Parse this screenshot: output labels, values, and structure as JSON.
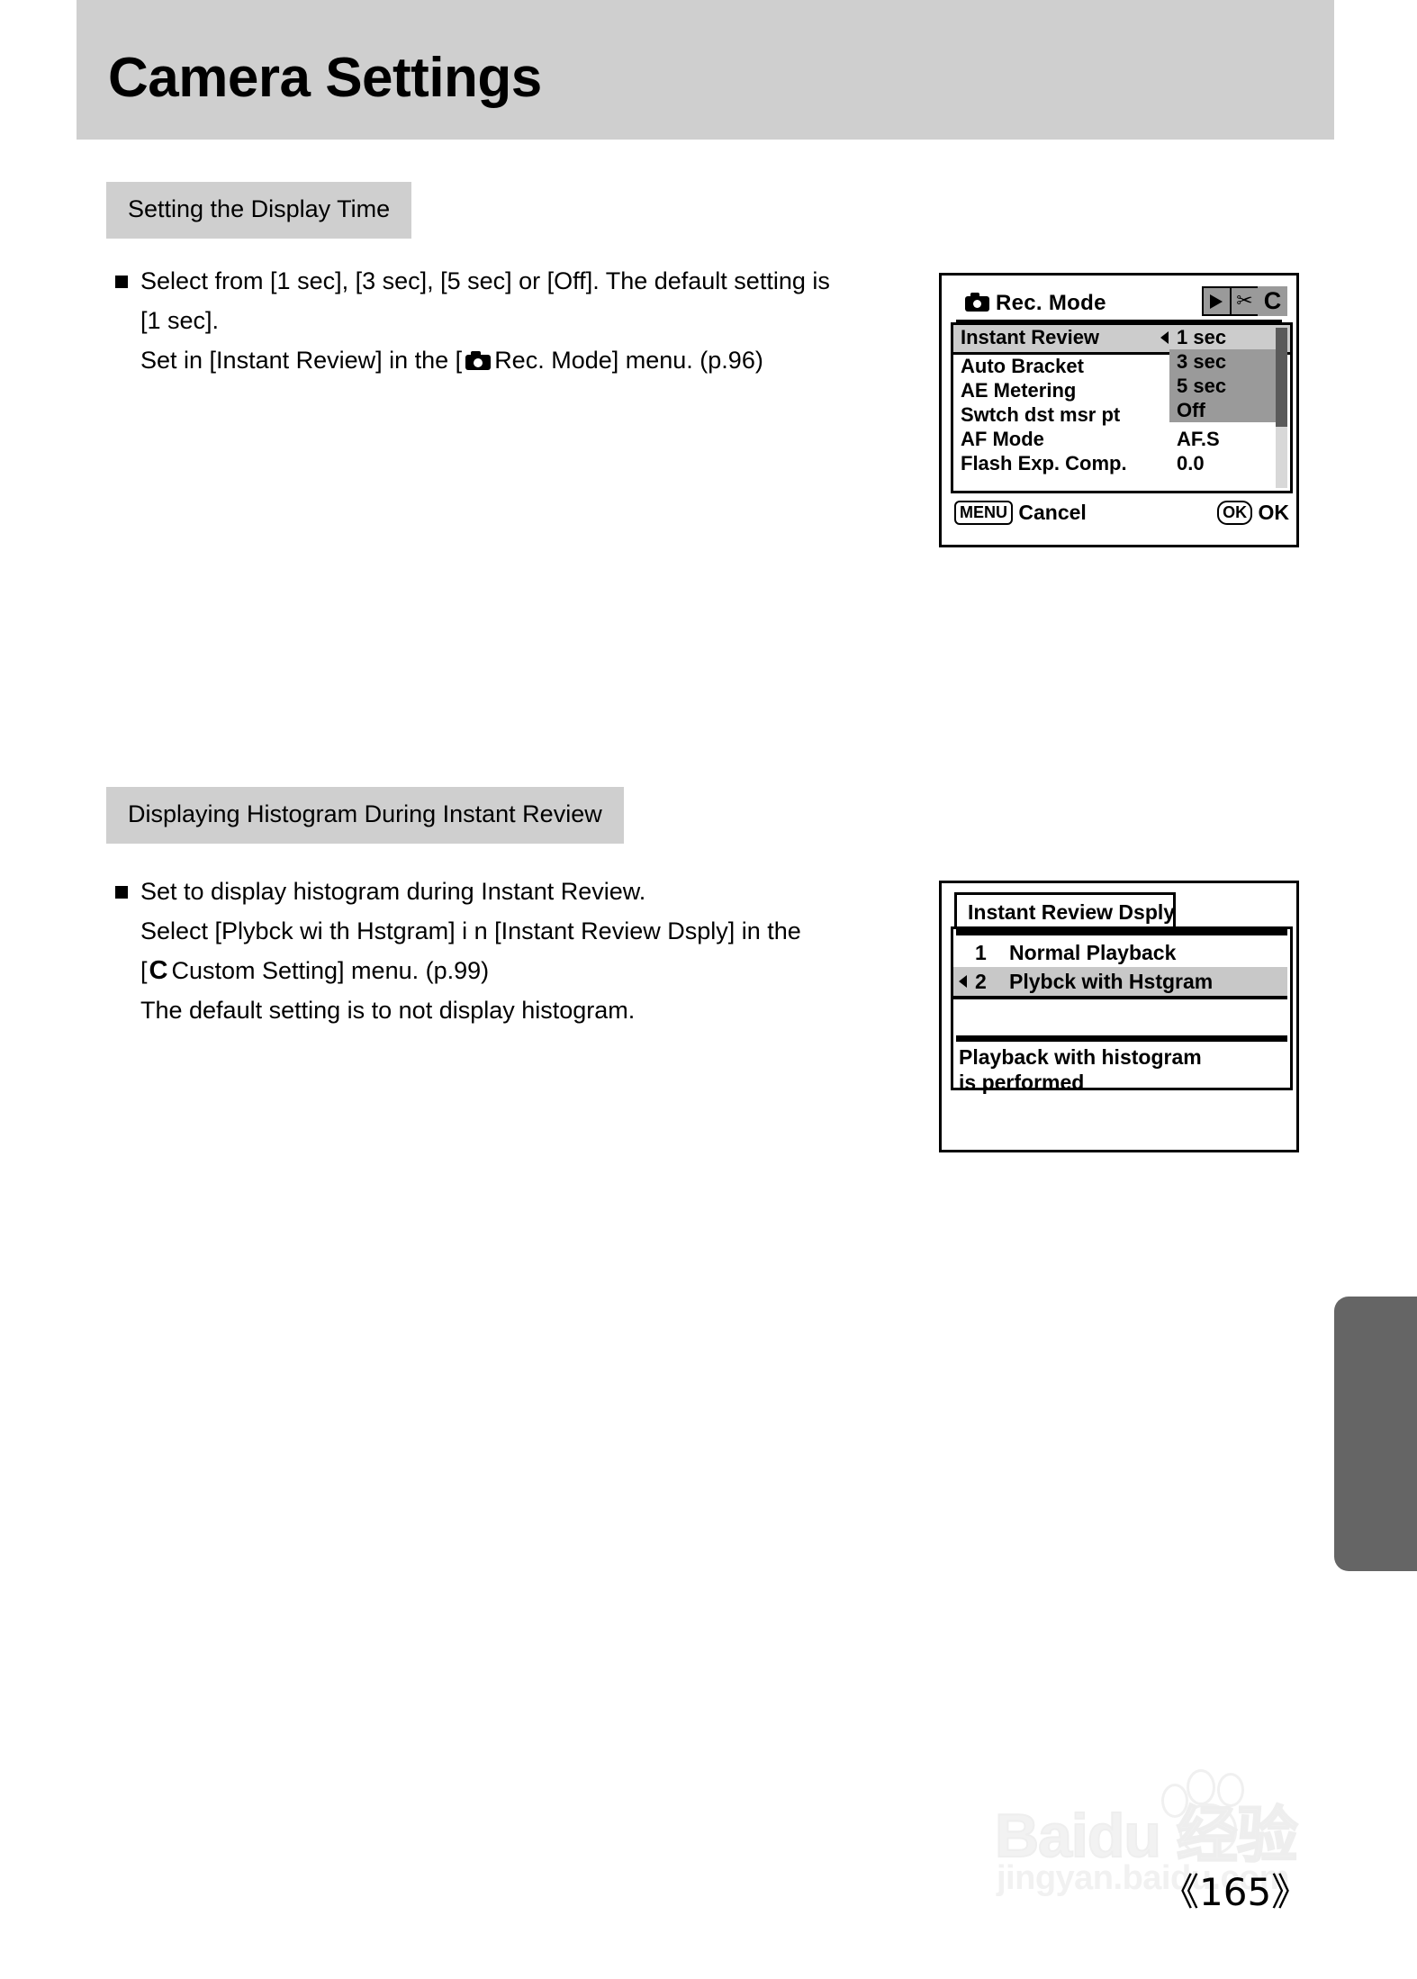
{
  "page": {
    "title": "Camera Settings",
    "number": "《165》"
  },
  "sections": [
    {
      "heading": "Setting the Display Time",
      "lines": [
        "Select from [1 sec], [3 sec], [5 sec] or [Off]. The default setting is",
        "[1 sec].",
        "Set in [Instant Review] in the [",
        "Rec. Mode] menu. (p.96)"
      ]
    },
    {
      "heading": "Displaying Histogram During Instant Review",
      "lines": [
        "Set to display histogram during Instant Review.",
        "Select [Plybck wi th Hstgram] i n [Instant Review Dsply] in the",
        "[",
        "Custom Setting] menu. (p.99)",
        "The default setting is to not display histogram."
      ],
      "c_glyph": "C"
    }
  ],
  "lcd_rec_mode": {
    "title": "Rec. Mode",
    "camera_icon": "camera-icon",
    "tabs": [
      "playback-icon",
      "wrench-icon",
      "C"
    ],
    "rows": [
      {
        "label": "Instant Review",
        "value": "1 sec"
      },
      {
        "label": "Auto Bracket",
        "value": ""
      },
      {
        "label": "AE Metering",
        "value": ""
      },
      {
        "label": "Swtch dst msr pt",
        "value": ""
      },
      {
        "label": "AF Mode",
        "value": "AF.S"
      },
      {
        "label": "Flash Exp. Comp.",
        "value": "0.0"
      }
    ],
    "dropdown": {
      "selected": "1 sec",
      "options": [
        "1 sec",
        "3 sec",
        "5 sec",
        "Off"
      ]
    },
    "footer": {
      "left_key": "MENU",
      "left_label": "Cancel",
      "right_key": "OK",
      "right_label": "OK"
    }
  },
  "lcd_instant_review_dsply": {
    "title": "Instant Review Dsply",
    "items": [
      {
        "num": "1",
        "text": "Normal Playback",
        "selected": false
      },
      {
        "num": "2",
        "text": "Plybck with Hstgram",
        "selected": true
      }
    ],
    "description_line_1": "Playback with histogram",
    "description_line_2": "is performed"
  },
  "watermark": {
    "brand": "Baidu 经验",
    "url": "jingyan.baidu.com"
  },
  "colors": {
    "header_band": "#cfcfcf",
    "chip": "#cfcfcf",
    "edge_tab": "#656565",
    "lcd_highlight": "#cccccc",
    "lcd_dropdown": "#9a9a9a"
  }
}
